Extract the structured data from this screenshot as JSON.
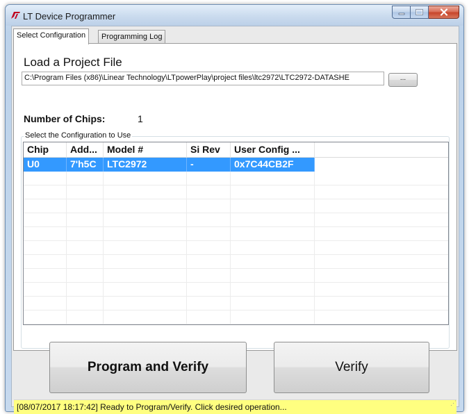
{
  "window": {
    "title": "LT Device Programmer",
    "app_icon": "lt-logo-icon",
    "controls": {
      "minimize_icon": "minimize-icon",
      "maximize_icon": "maximize-icon",
      "close_icon": "close-icon"
    }
  },
  "tabs": [
    {
      "label": "Select Configuration",
      "active": true
    },
    {
      "label": "Programming Log",
      "active": false
    }
  ],
  "load_section": {
    "heading": "Load a Project File",
    "path_value": "C:\\Program Files (x86)\\Linear Technology\\LTpowerPlay\\project files\\ltc2972\\LTC2972-DATASHE",
    "browse_label": "..."
  },
  "chips": {
    "label": "Number of Chips:",
    "value": "1"
  },
  "config_group": {
    "caption": "Select the Configuration to Use"
  },
  "grid": {
    "columns": [
      "Chip",
      "Add...",
      "Model #",
      "Si Rev",
      "User Config ..."
    ],
    "rows": [
      {
        "chip": "U0",
        "address": "7'h5C",
        "model": "LTC2972",
        "si_rev": "-",
        "user_config": "0x7C44CB2F",
        "selected": true
      }
    ]
  },
  "actions": {
    "program_verify_label": "Program and Verify",
    "verify_label": "Verify"
  },
  "status": {
    "text": "[08/07/2017 18:17:42] Ready to Program/Verify.  Click desired operation...",
    "color": "#ffff80"
  },
  "colors": {
    "selection": "#3399ff",
    "status_bg": "#ffff80",
    "close_button": "#c7452b"
  }
}
